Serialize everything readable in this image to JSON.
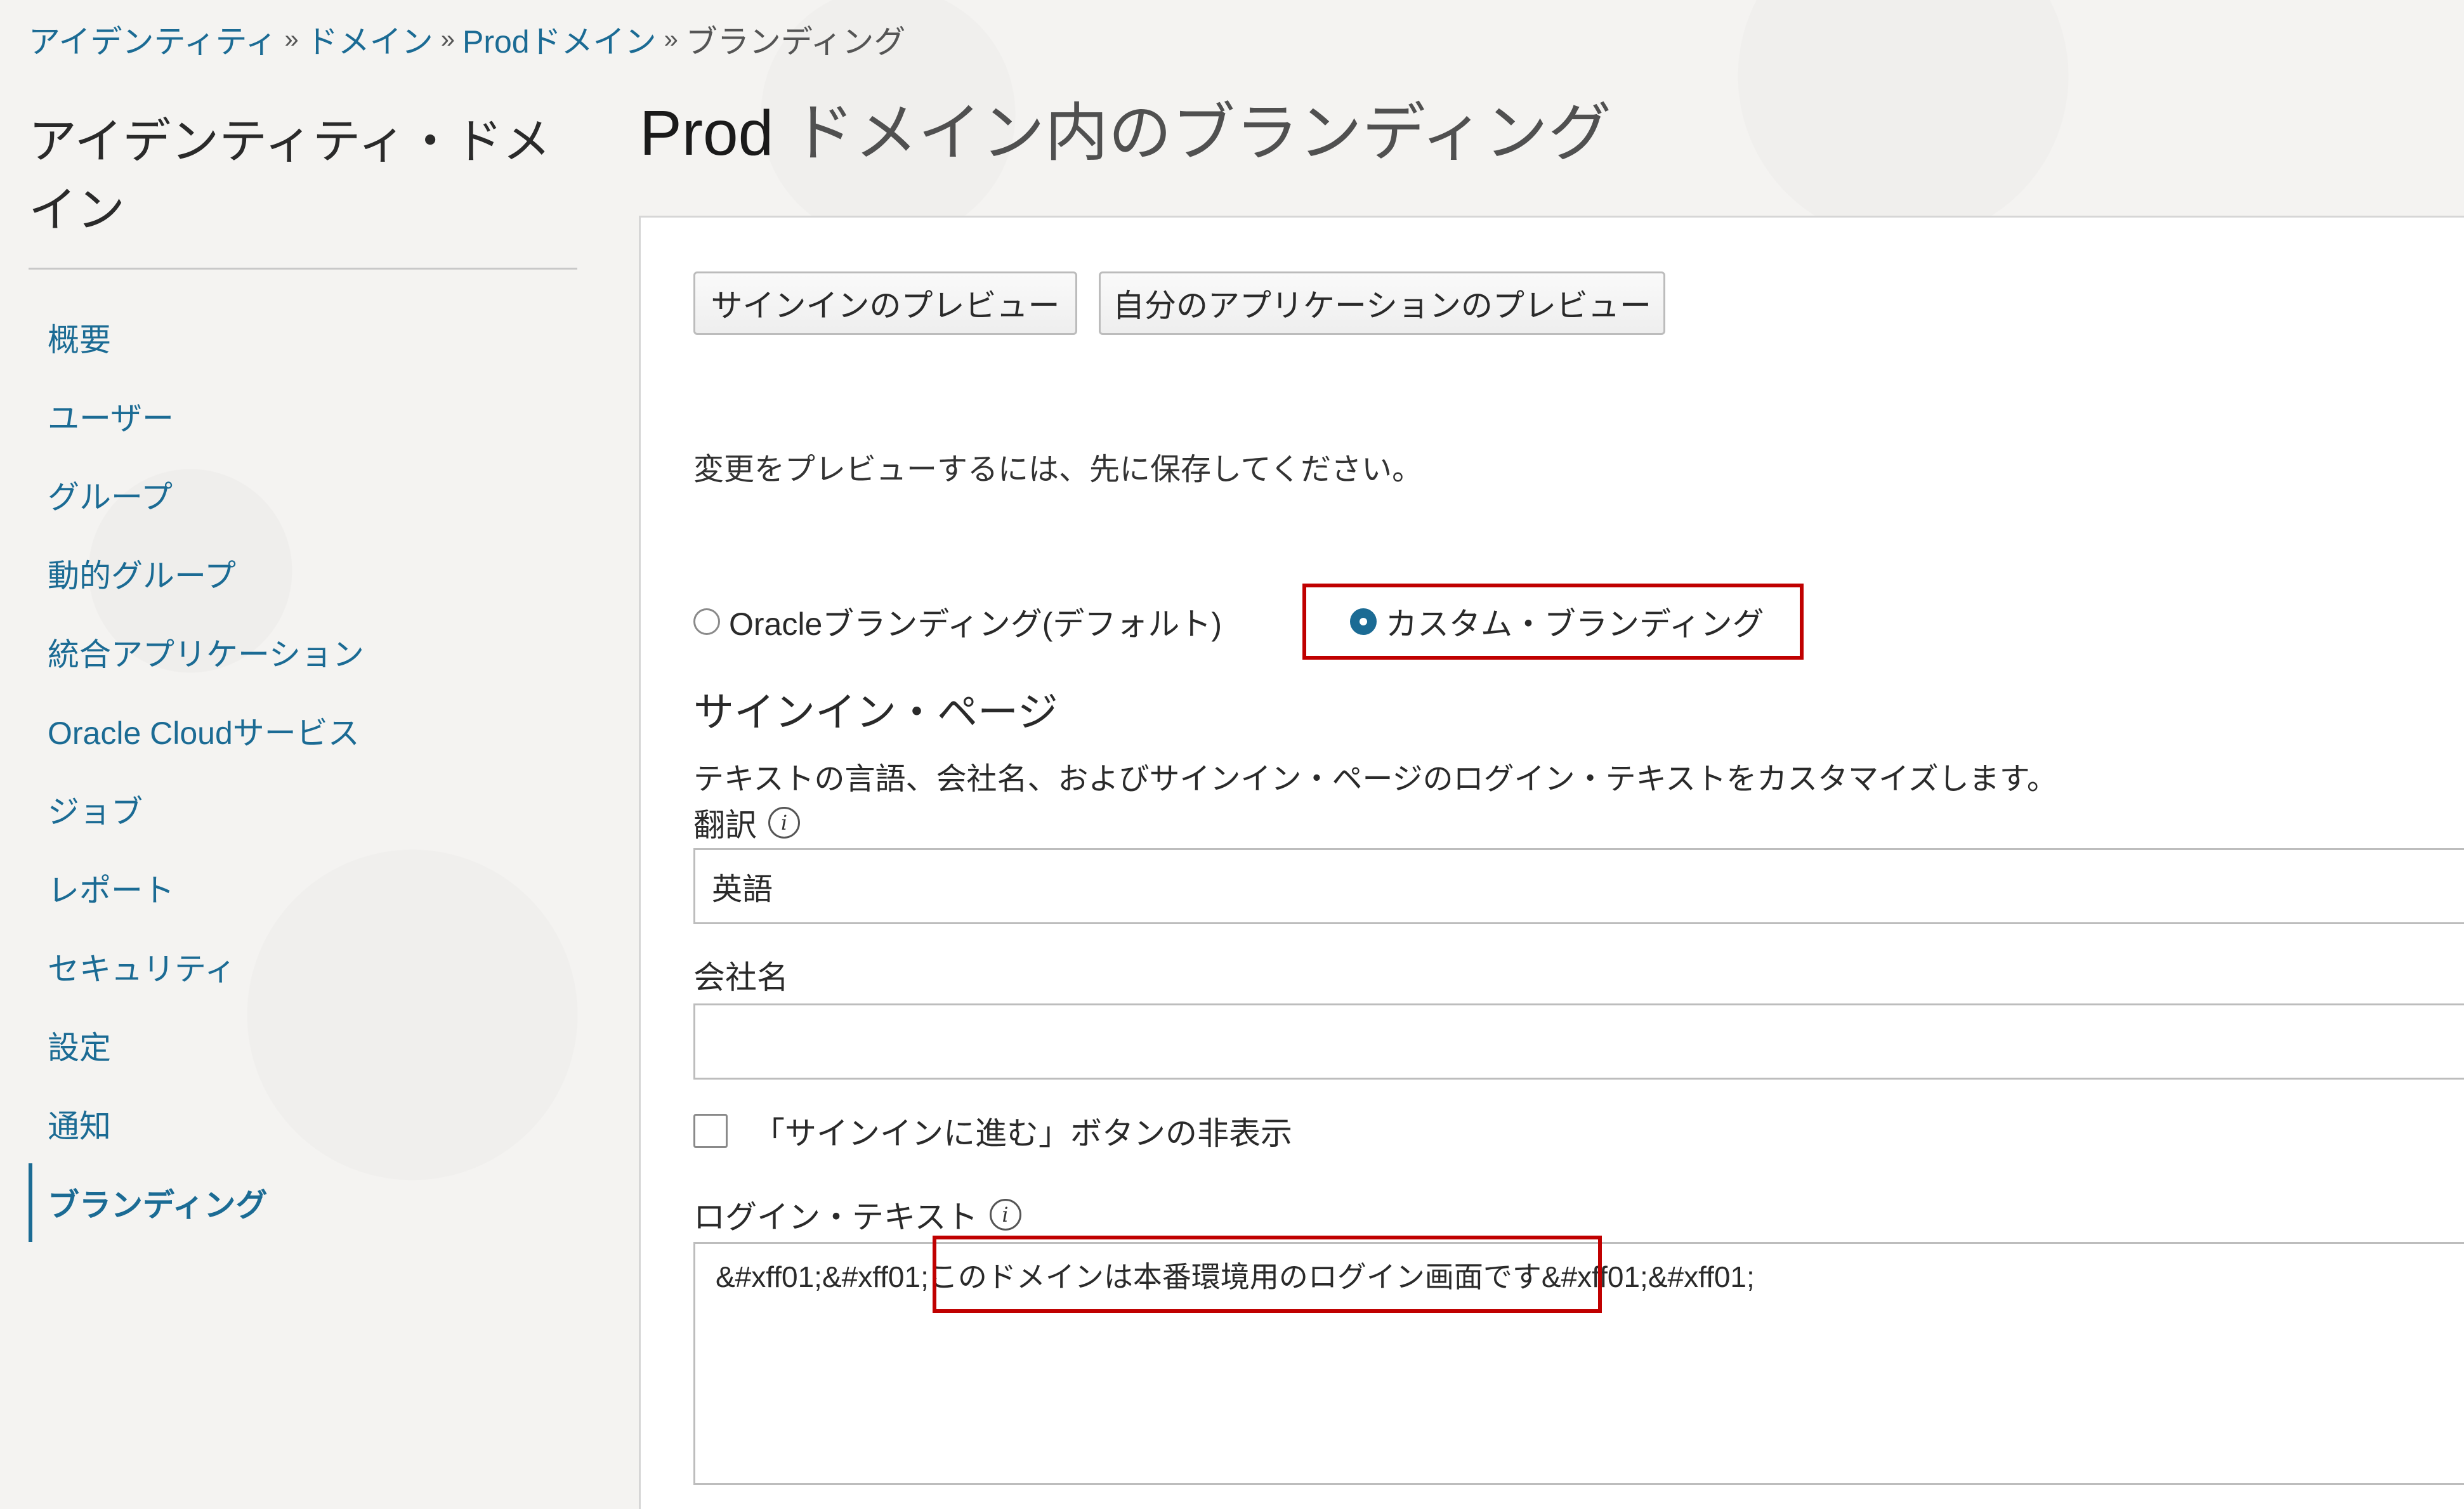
{
  "breadcrumb": {
    "items": [
      {
        "label": "アイデンティティ"
      },
      {
        "label": "ドメイン"
      },
      {
        "label": "Prodドメイン"
      }
    ],
    "separator": "»",
    "current": "ブランディング"
  },
  "sidebar": {
    "title": "アイデンティティ・ドメイン",
    "items": [
      {
        "label": "概要"
      },
      {
        "label": "ユーザー"
      },
      {
        "label": "グループ"
      },
      {
        "label": "動的グループ"
      },
      {
        "label": "統合アプリケーション"
      },
      {
        "label": "Oracle Cloudサービス"
      },
      {
        "label": "ジョブ"
      },
      {
        "label": "レポート"
      },
      {
        "label": "セキュリティ"
      },
      {
        "label": "設定"
      },
      {
        "label": "通知"
      },
      {
        "label": "ブランディング",
        "active": true
      }
    ]
  },
  "page": {
    "title_prod": "Prod",
    "title_rest": " ドメイン内のブランディング"
  },
  "toolbar": {
    "preview_signin": "サインインのプレビュー",
    "preview_apps": "自分のアプリケーションのプレビュー"
  },
  "hint": "変更をプレビューするには、先に保存してください。",
  "branding_options": {
    "oracle": "Oracleブランディング(デフォルト)",
    "custom": "カスタム・ブランディング",
    "selected": "custom"
  },
  "signin_section": {
    "title": "サインイン・ページ",
    "description": "テキストの言語、会社名、およびサインイン・ページのログイン・テキストをカスタマイズします。",
    "translation_label": "翻訳",
    "translation_value": "英語",
    "company_label": "会社名",
    "company_value": "",
    "hide_button_label": "「サインインに進む」ボタンの非表示",
    "hide_button_checked": false,
    "login_text_label": "ログイン・テキスト",
    "login_text_value": "&#xff01;&#xff01;このドメインは本番環境用のログイン画面です&#xff01;&#xff01;"
  },
  "colors": {
    "link": "#1b6b94",
    "highlight": "#c00000"
  },
  "icons": {
    "info": "info-icon"
  }
}
